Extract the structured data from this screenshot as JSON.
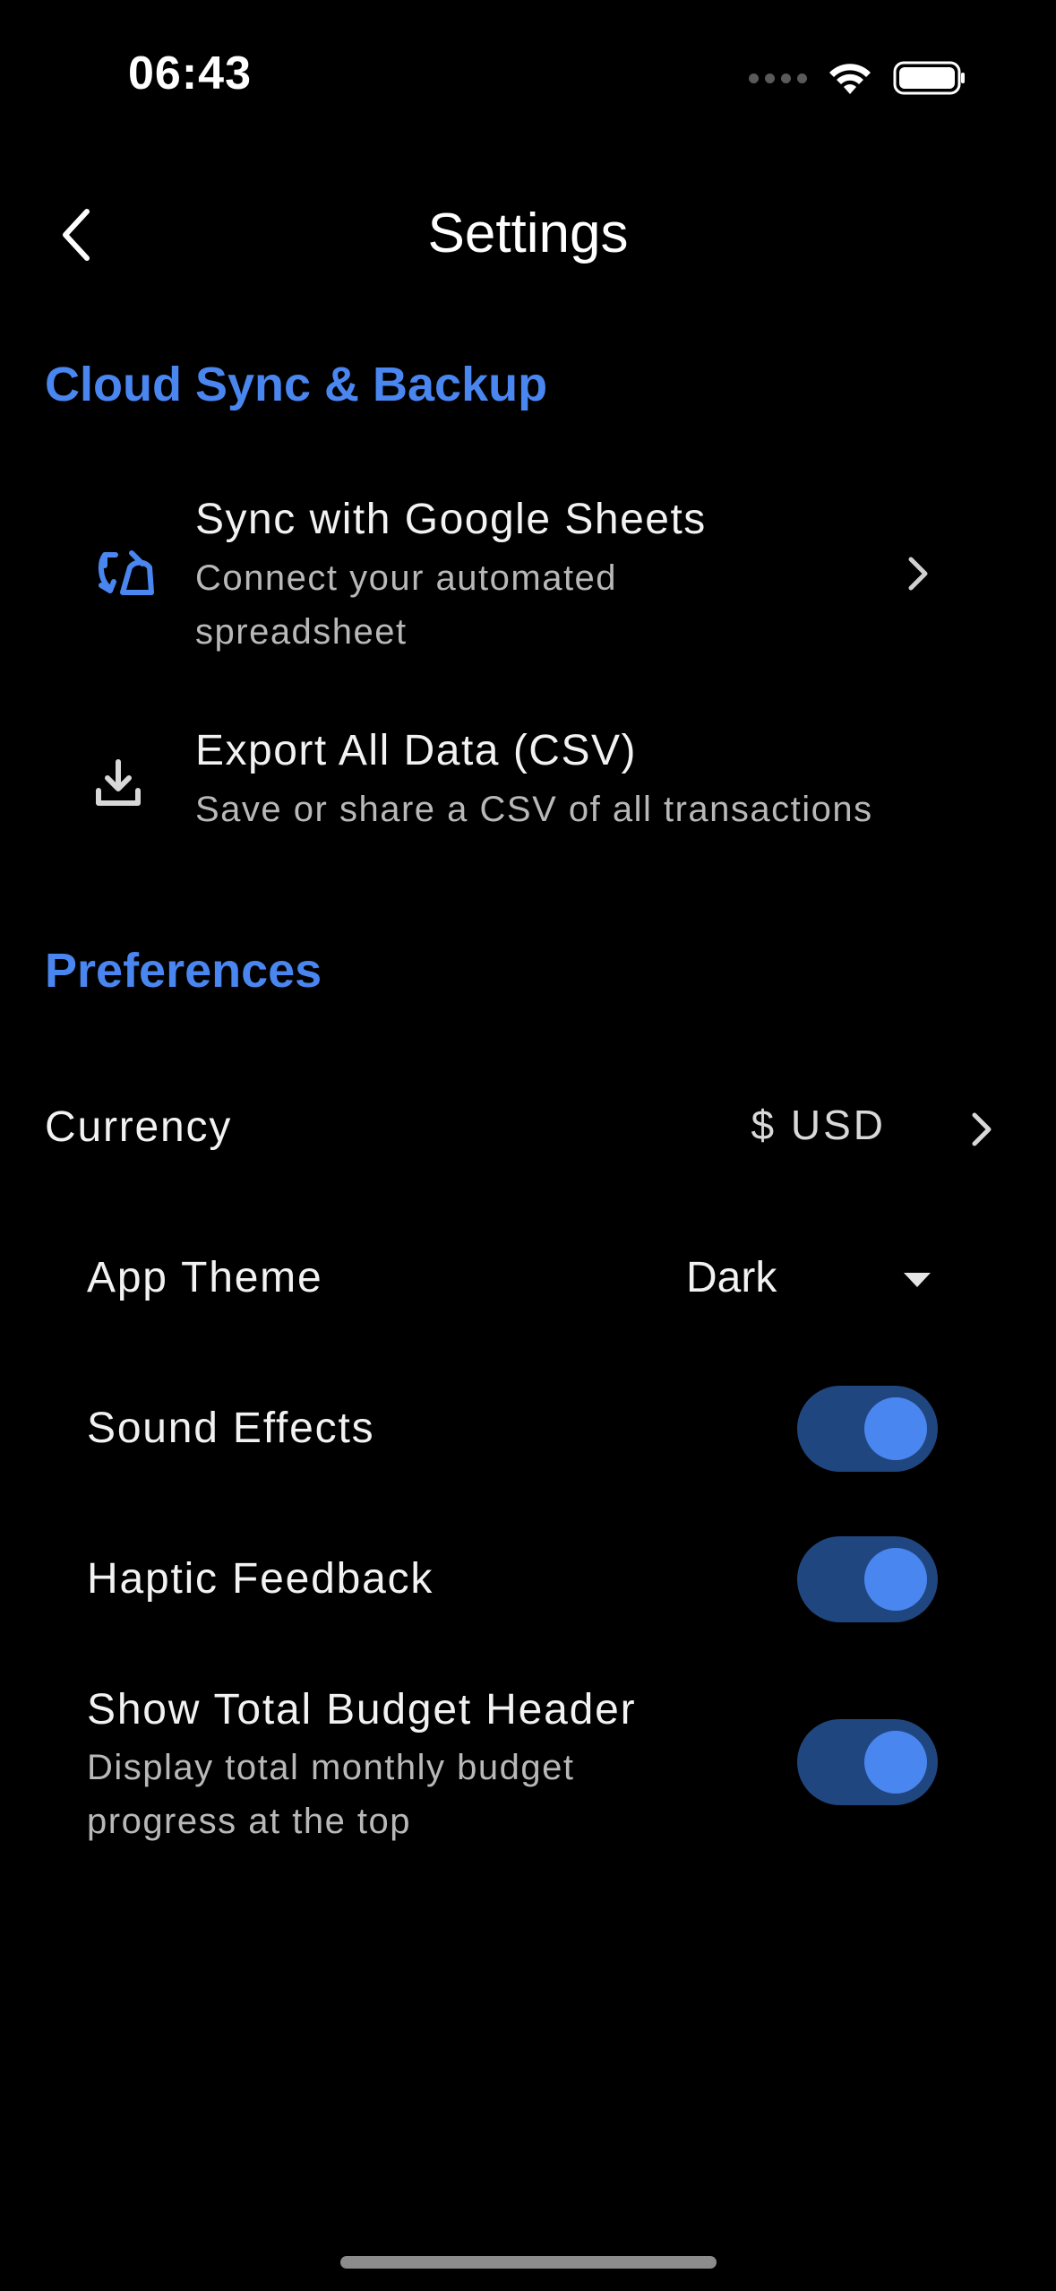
{
  "status_bar": {
    "time": "06:43"
  },
  "nav": {
    "title": "Settings"
  },
  "cloud_section": {
    "header": "Cloud Sync & Backup",
    "items": [
      {
        "title": "Sync with Google Sheets",
        "subtitle_line1": "Connect your automated",
        "subtitle_line2": "spreadsheet",
        "icon": "sync-icon"
      },
      {
        "title": "Export All Data (CSV)",
        "subtitle": "Save or share a CSV of all transactions",
        "icon": "download-icon"
      }
    ]
  },
  "preferences_section": {
    "header": "Preferences",
    "currency": {
      "label": "Currency",
      "value": "$  USD"
    },
    "theme": {
      "label": "App Theme",
      "value": "Dark"
    },
    "sound_effects": {
      "label": "Sound Effects",
      "enabled": true
    },
    "haptic_feedback": {
      "label": "Haptic Feedback",
      "enabled": true
    },
    "budget_header": {
      "label": "Show Total Budget Header",
      "subtitle_line1": "Display total monthly budget",
      "subtitle_line2": "progress at the top",
      "enabled": true
    }
  },
  "colors": {
    "accent": "#4a86f0",
    "toggle_track": "#20467f",
    "background": "#000000"
  }
}
